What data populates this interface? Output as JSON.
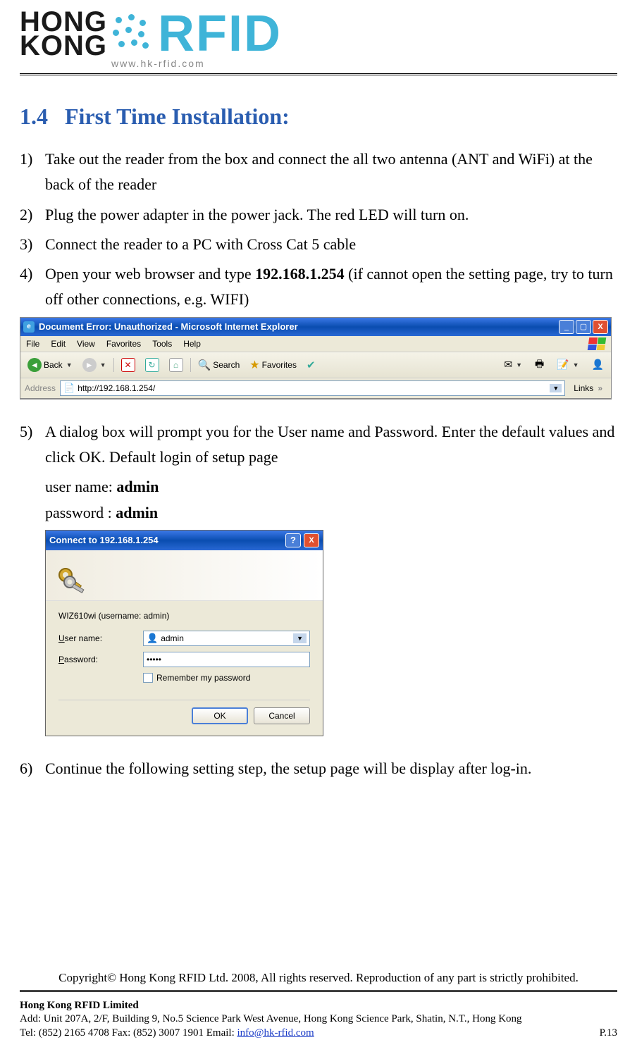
{
  "logo": {
    "hk_line1": "HONG",
    "hk_line2": "KONG",
    "rfid": "RFID",
    "url": "www.hk-rfid.com"
  },
  "section": {
    "number": "1.4",
    "title": "First Time Installation:"
  },
  "steps": {
    "s1": "Take out the reader from the box and connect the all two antenna (ANT and WiFi) at the back of the reader",
    "s2": "Plug the power adapter in the power jack. The red LED will turn on.",
    "s3": "Connect the reader to a PC with Cross Cat 5 cable",
    "s4_pre": "Open your web browser and type ",
    "s4_bold": "192.168.1.254",
    "s4_post": " (if cannot open the setting page, try to turn off other connections, e.g. WIFI)",
    "s5": "A dialog box will prompt you for the User name and Password. Enter the default values and click OK. Default login of setup page",
    "s5_user_label": "user name: ",
    "s5_user_value": "admin",
    "s5_pass_label": "password : ",
    "s5_pass_value": "admin",
    "s6": "Continue the following setting step, the setup page will be display after log-in."
  },
  "ie": {
    "title": "Document Error: Unauthorized - Microsoft Internet Explorer",
    "menu": {
      "file": "File",
      "edit": "Edit",
      "view": "View",
      "favorites": "Favorites",
      "tools": "Tools",
      "help": "Help"
    },
    "toolbar": {
      "back": "Back",
      "search": "Search",
      "favorites": "Favorites"
    },
    "address_label": "Address",
    "address_value": "http://192.168.1.254/",
    "links": "Links"
  },
  "auth": {
    "title": "Connect to 192.168.1.254",
    "server": "WIZ610wi (username: admin)",
    "user_label_pre": "U",
    "user_label_post": "ser name:",
    "pass_label_pre": "P",
    "pass_label_post": "assword:",
    "user_value": "admin",
    "pass_value": "•••••",
    "remember_pre": "R",
    "remember_post": "emember my password",
    "ok": "OK",
    "cancel": "Cancel"
  },
  "copyright": "Copyright©  Hong Kong RFID Ltd. 2008, All rights reserved. Reproduction of any part is strictly prohibited.",
  "footer": {
    "name": "Hong Kong RFID Limited",
    "addr": "Add: Unit 207A, 2/F, Building 9, No.5 Science Park West Avenue, Hong Kong Science Park, Shatin, N.T., Hong Kong",
    "tel": "Tel: (852) 2165 4708   Fax: (852) 3007 1901   Email: ",
    "email": "info@hk-rfid.com",
    "page": "P.13"
  }
}
